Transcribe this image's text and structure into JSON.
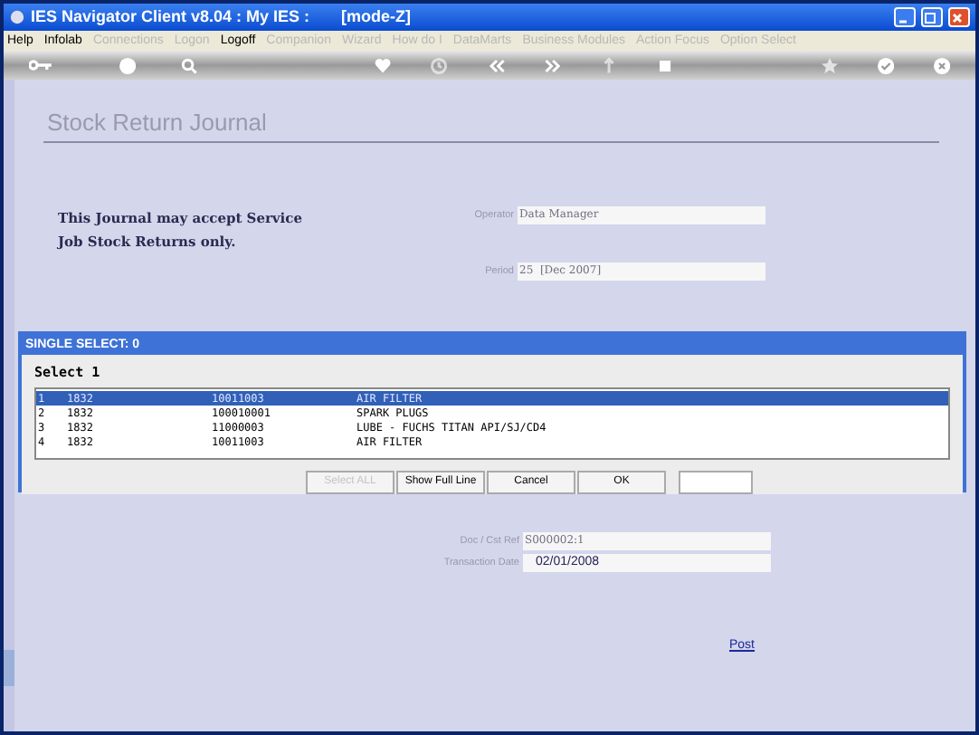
{
  "window": {
    "title": "IES Navigator Client v8.04 : My IES :       [mode-Z]"
  },
  "menu": [
    {
      "label": "Help",
      "disabled": false
    },
    {
      "label": "Infolab",
      "disabled": false
    },
    {
      "label": "Connections",
      "disabled": true
    },
    {
      "label": "Logon",
      "disabled": true
    },
    {
      "label": "Logoff",
      "disabled": false
    },
    {
      "label": "Companion",
      "disabled": true
    },
    {
      "label": "Wizard",
      "disabled": true
    },
    {
      "label": "How do I",
      "disabled": true
    },
    {
      "label": "DataMarts",
      "disabled": true
    },
    {
      "label": "Business Modules",
      "disabled": true
    },
    {
      "label": "Action Focus",
      "disabled": true
    },
    {
      "label": "Option Select",
      "disabled": true
    }
  ],
  "page": {
    "title": "Stock Return Journal",
    "note": "This Journal may accept Service Job Stock Returns only.",
    "fields_top": [
      {
        "label": "Operator",
        "value": "Data Manager"
      },
      {
        "label": "Period",
        "value": "25  [Dec 2007]"
      }
    ],
    "fields_bottom": [
      {
        "label": "Doc / Cst Ref",
        "value": "S000002:1",
        "kind": "readonly"
      },
      {
        "label": "Transaction Date",
        "value": "02/01/2008",
        "kind": "editable"
      }
    ],
    "post_link": "Post"
  },
  "dialog": {
    "title": "SINGLE SELECT: 0",
    "prompt": "Select 1",
    "rows": [
      {
        "cells": [
          "1",
          "1832",
          "10011003",
          "AIR FILTER"
        ],
        "selected": true
      },
      {
        "cells": [
          "2",
          "1832",
          "100010001",
          "SPARK PLUGS"
        ],
        "selected": false
      },
      {
        "cells": [
          "3",
          "1832",
          "11000003",
          "LUBE - FUCHS TITAN API/SJ/CD4"
        ],
        "selected": false
      },
      {
        "cells": [
          "4",
          "1832",
          "10011003",
          "AIR FILTER"
        ],
        "selected": false
      }
    ],
    "buttons": [
      {
        "label": "Select ALL",
        "disabled": true
      },
      {
        "label": "Show Full Line",
        "disabled": false
      },
      {
        "label": "Cancel",
        "disabled": false
      },
      {
        "label": "OK",
        "disabled": false
      }
    ]
  }
}
